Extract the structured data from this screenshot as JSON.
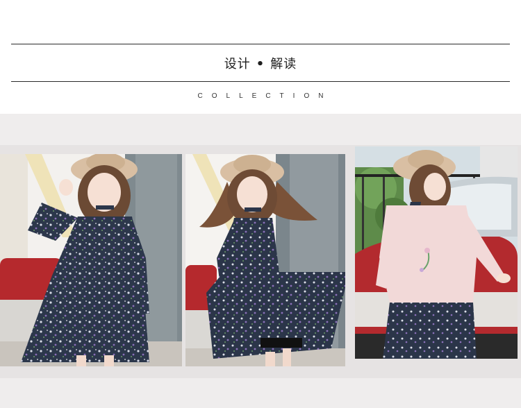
{
  "header": {
    "title_left": "设计",
    "title_dot": "•",
    "title_right": "解读",
    "subtitle": "COLLECTION"
  },
  "photos": [
    {
      "name": "model-floral-dress-front",
      "description_icon": "photo-icon"
    },
    {
      "name": "model-floral-dress-twirl",
      "description_icon": "photo-icon"
    },
    {
      "name": "model-pink-jacket-back",
      "description_icon": "photo-icon"
    }
  ],
  "colors": {
    "rule": "#2a2a2a",
    "band": "#efeded",
    "dress": "#2f3a4d",
    "jacket": "#f2d9d8",
    "car": "#b32a2e",
    "hat": "#d9bfa3"
  }
}
